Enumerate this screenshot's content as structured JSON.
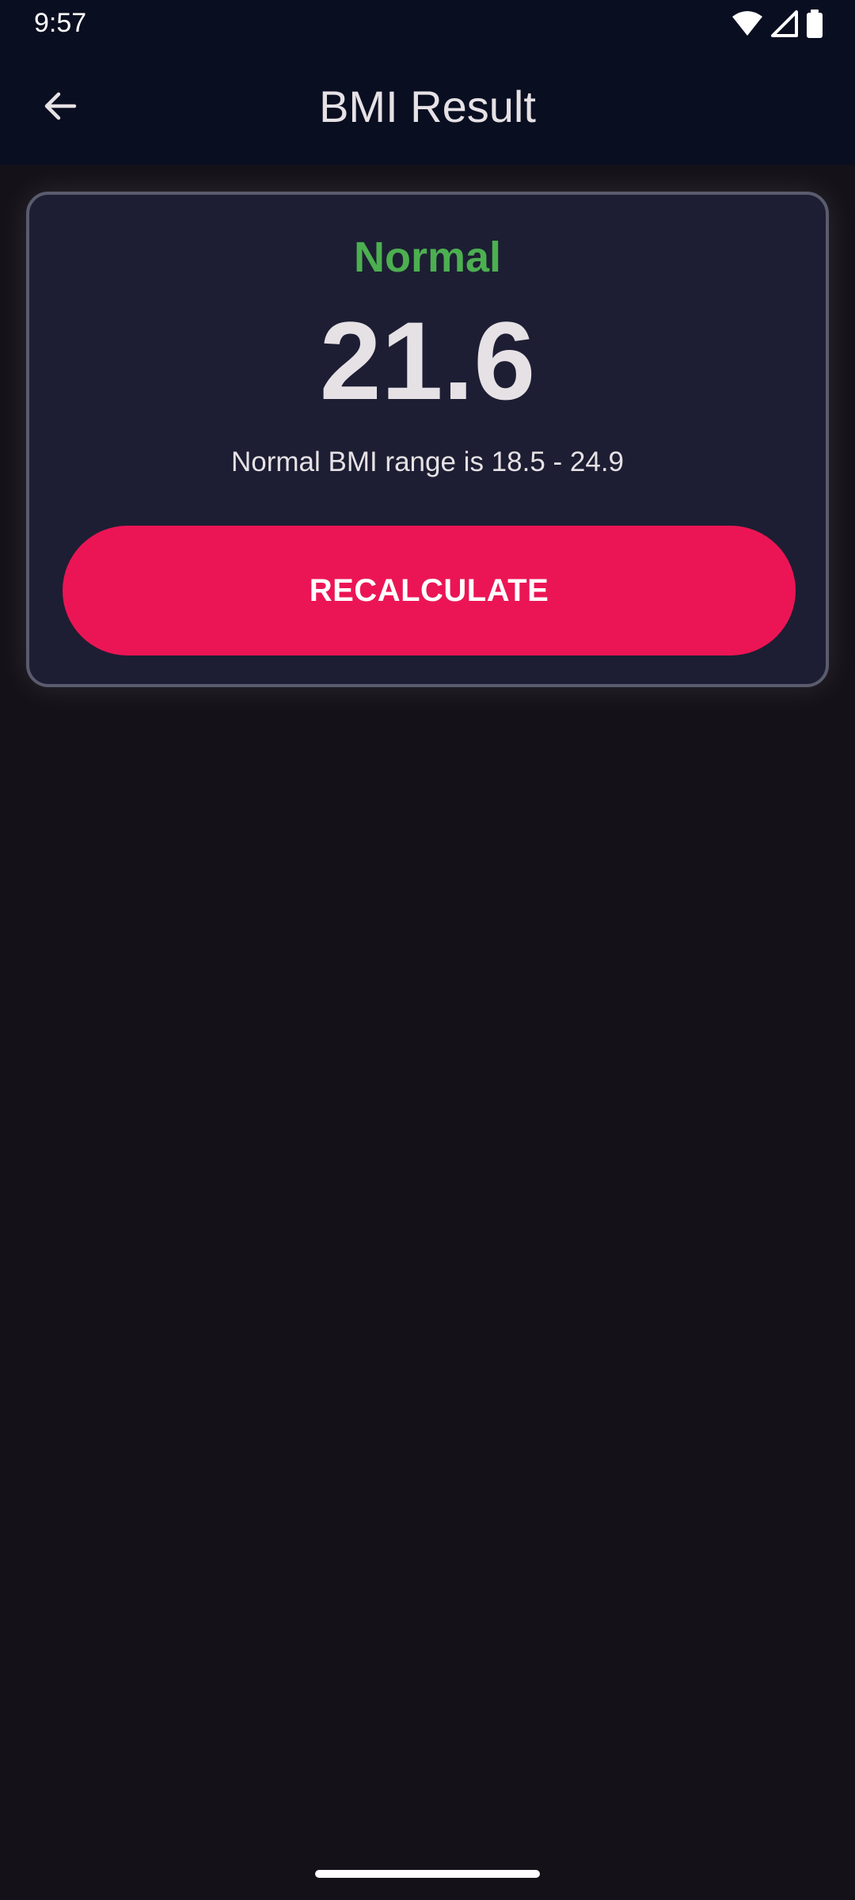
{
  "status_bar": {
    "time": "9:57",
    "icons": [
      "wifi-icon",
      "signal-icon",
      "battery-icon"
    ]
  },
  "app_bar": {
    "title": "BMI Result",
    "back_icon": "arrow-left-icon"
  },
  "result": {
    "status": "Normal",
    "bmi_value": "21.6",
    "range_text": "Normal BMI range is 18.5 - 24.9",
    "recalculate_label": "RECALCULATE"
  },
  "colors": {
    "app_bar_bg": "#0a0e21",
    "background": "#141218",
    "card_bg": "#1d1e33",
    "status_color": "#4caf50",
    "accent": "#eb1555",
    "text": "#e6e1e5"
  }
}
